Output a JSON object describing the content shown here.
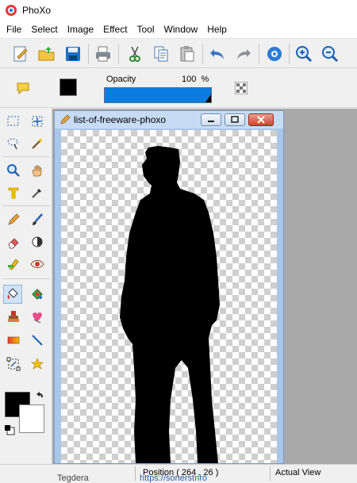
{
  "app": {
    "title": "PhoXo"
  },
  "menu": [
    "File",
    "Select",
    "Image",
    "Effect",
    "Tool",
    "Window",
    "Help"
  ],
  "toolbar": {
    "buttons": [
      "new-icon",
      "open-icon",
      "save-icon",
      "print-icon",
      "cut-icon",
      "copy-icon",
      "paste-icon",
      "undo-icon",
      "redo-icon",
      "settings-icon",
      "zoom-in-icon",
      "zoom-out-icon"
    ]
  },
  "properties": {
    "opacity_label": "Opacity",
    "opacity_value": "100",
    "opacity_unit": "%",
    "opacity_fraction": 1.0,
    "shape_color": "#000000"
  },
  "document": {
    "title": "list-of-freeware-phoxo",
    "minimize_icon": "minimize-icon",
    "restore_icon": "restore-icon",
    "close_icon": "close-icon"
  },
  "colors": {
    "foreground": "#000000",
    "background": "#ffffff"
  },
  "status": {
    "position": "Position ( 264 , 26 )",
    "view": "Actual View",
    "behind_text": "Tegdera",
    "behind_link": "https://sonerstriro"
  }
}
